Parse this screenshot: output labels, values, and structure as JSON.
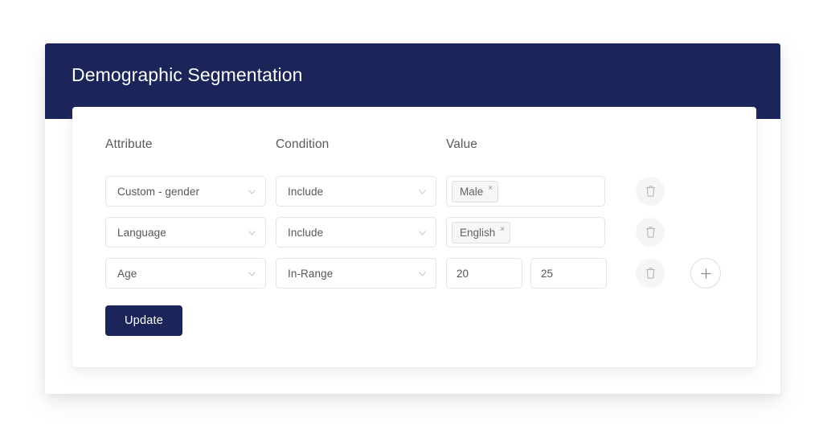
{
  "header": {
    "title": "Demographic Segmentation"
  },
  "colors": {
    "brand_navy": "#1b2559",
    "card_background": "#ffffff",
    "field_border": "#e3e3e5",
    "tag_background": "#f6f6f7",
    "label_text": "#5a5a5a"
  },
  "table": {
    "columns": [
      {
        "key": "attribute",
        "label": "Attribute"
      },
      {
        "key": "condition",
        "label": "Condition"
      },
      {
        "key": "value",
        "label": "Value"
      }
    ],
    "rows": [
      {
        "attribute": "Custom - gender",
        "condition": "Include",
        "value_type": "tag",
        "tags": [
          {
            "label": "Male",
            "remove": "×"
          }
        ],
        "delete_icon": "trash-icon"
      },
      {
        "attribute": "Language",
        "condition": "Include",
        "value_type": "tag",
        "tags": [
          {
            "label": "English",
            "remove": "×"
          }
        ],
        "delete_icon": "trash-icon"
      },
      {
        "attribute": "Age",
        "condition": "In-Range",
        "value_type": "range",
        "range_min": "20",
        "range_max": "25",
        "delete_icon": "trash-icon",
        "add_icon": "plus-icon"
      }
    ]
  },
  "icons": {
    "chevron": "chevron-down-icon",
    "trash": "trash-icon",
    "plus": "plus-icon"
  },
  "actions": {
    "update_label": "Update"
  }
}
